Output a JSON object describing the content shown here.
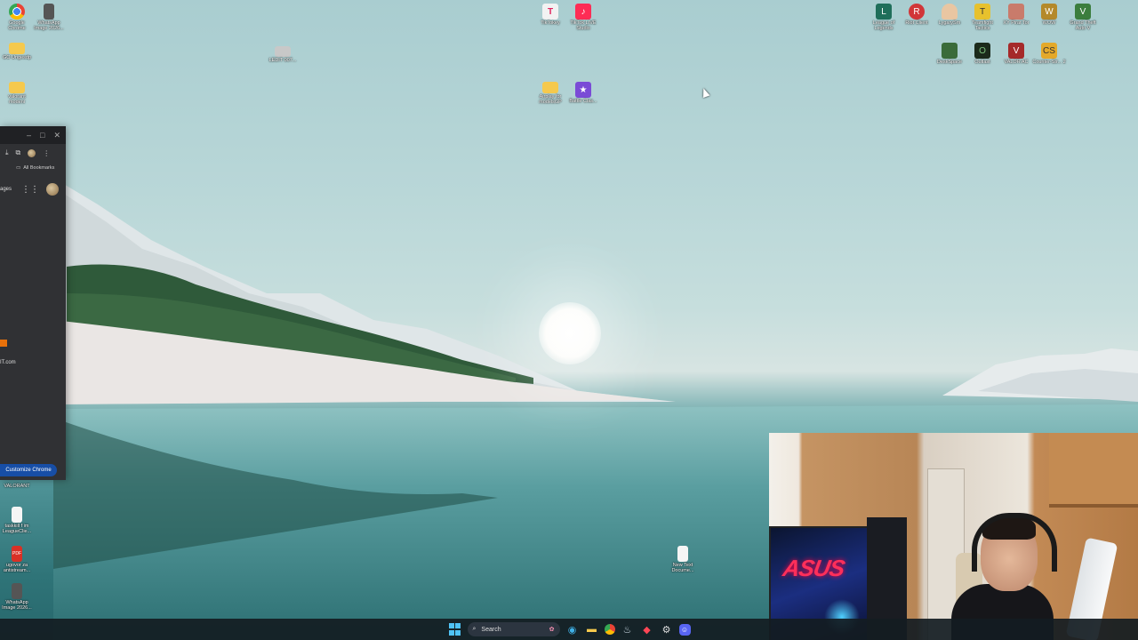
{
  "desktop": {
    "icons_left": [
      {
        "label": "Google Chrome",
        "icon": "chrome-icon",
        "color": "#e84335"
      },
      {
        "label": "WhatsApp Image 2026...",
        "icon": "image-file-icon",
        "color": "#555555"
      },
      {
        "label": "GO Ungesdp",
        "icon": "folder-icon",
        "color": "#f5c94d"
      },
      {
        "label": "valorant modeni",
        "icon": "folder-icon",
        "color": "#f5c94d"
      }
    ],
    "icons_center": [
      {
        "label": "LEDIT 007...",
        "icon": "app-icon",
        "color": "#c8c8c8"
      },
      {
        "label": "TikTokey",
        "icon": "tiktok-icon",
        "color": "#e8e8e8"
      },
      {
        "label": "TikTok LIVE Studio",
        "icon": "tiktok-live-icon",
        "color": "#fe2c55"
      },
      {
        "label": "Airplay for modelsGP",
        "icon": "folder-icon",
        "color": "#f5c94d"
      },
      {
        "label": "Battle Clas...",
        "icon": "game-icon",
        "color": "#7a4bd6"
      }
    ],
    "icons_right_row1": [
      {
        "label": "League of Legends",
        "icon": "league-icon",
        "color": "#1f6e5a"
      },
      {
        "label": "Riot Client",
        "icon": "riot-icon",
        "color": "#d13639"
      },
      {
        "label": "LygarySm",
        "icon": "app-icon",
        "color": "#e9c6a2"
      },
      {
        "label": "Teamfight Tactics",
        "icon": "tft-icon",
        "color": "#e7c12d"
      },
      {
        "label": "XY Pirat Tor",
        "icon": "app-icon",
        "color": "#c97b6b"
      },
      {
        "label": "WOW",
        "icon": "wow-icon",
        "color": "#b4892a"
      },
      {
        "label": "Grand Theft Auto V",
        "icon": "gta-icon",
        "color": "#3b7d3d"
      }
    ],
    "icons_right_row2": [
      {
        "label": "DeskSpace",
        "icon": "app-icon",
        "color": "#3a6b3a"
      },
      {
        "label": "Outlast",
        "icon": "outlast-icon",
        "color": "#1b2a1b"
      },
      {
        "label": "VALOR AC",
        "icon": "valorant-ac-icon",
        "color": "#a52a2a"
      },
      {
        "label": "Counter-Str... 2",
        "icon": "cs2-icon",
        "color": "#e4a92a"
      }
    ],
    "icons_bottom_left": [
      {
        "label": "VALORANT",
        "icon": "valorant-icon",
        "color": "#fa4454"
      },
      {
        "label": "taskkill f im LeagueClie...",
        "icon": "text-file-icon",
        "color": "#f5f5f5"
      },
      {
        "label": "ugovor za antistream...",
        "icon": "pdf-icon",
        "color": "#d93025"
      },
      {
        "label": "WhatsApp Image 2026...",
        "icon": "image-file-icon",
        "color": "#555555"
      }
    ],
    "icons_bottom_center": [
      {
        "label": "New Text Docume...",
        "icon": "text-file-icon",
        "color": "#f5f5f5"
      }
    ]
  },
  "chrome": {
    "bookmarks_label": "All Bookmarks",
    "ntp_left_text": "ages",
    "shortcut_label": "IT.com",
    "customize_label": "Customize Chrome"
  },
  "taskbar": {
    "search_placeholder": "Search",
    "apps": [
      "start-icon",
      "search",
      "widgets-icon",
      "edge-icon",
      "file-explorer-icon",
      "chrome-icon",
      "steam-icon",
      "valorant-ac-icon",
      "settings-icon",
      "discord-icon"
    ]
  },
  "webcam": {
    "brand_text": "ASUS"
  },
  "colors": {
    "accent": "#174ea6",
    "taskbar": "#141c22",
    "chrome_bg": "#303134"
  }
}
